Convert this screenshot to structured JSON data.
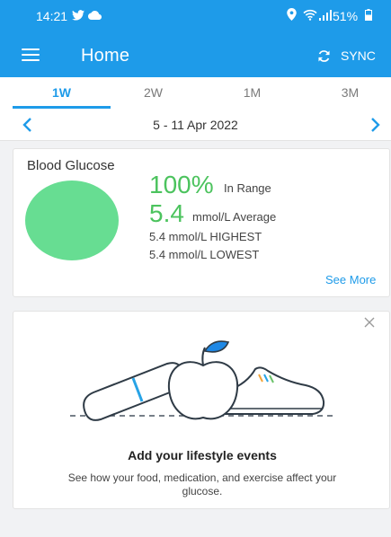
{
  "status_bar": {
    "time": "14:21",
    "battery": "51%"
  },
  "app_bar": {
    "title": "Home",
    "sync_label": "SYNC"
  },
  "tabs": [
    {
      "label": "1W",
      "active": true
    },
    {
      "label": "2W",
      "active": false
    },
    {
      "label": "1M",
      "active": false
    },
    {
      "label": "3M",
      "active": false
    }
  ],
  "date_nav": {
    "range": "5 - 11 Apr 2022"
  },
  "glucose_card": {
    "title": "Blood Glucose",
    "in_range_percent": "100%",
    "in_range_label": "In Range",
    "average_value": "5.4",
    "average_label": "mmol/L Average",
    "highest": "5.4 mmol/L HIGHEST",
    "lowest": "5.4 mmol/L LOWEST",
    "see_more": "See More",
    "chart_color": "#67dd92"
  },
  "lifestyle_card": {
    "title": "Add your lifestyle events",
    "description": "See how your food, medication, and exercise affect your glucose."
  },
  "colors": {
    "accent": "#1e9be9",
    "in_range_green": "#4cc35e"
  }
}
